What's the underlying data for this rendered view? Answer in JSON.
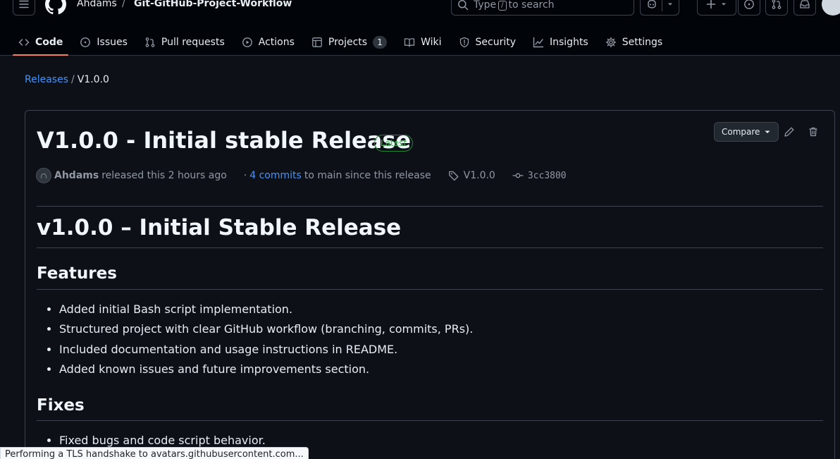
{
  "header": {
    "owner": "Ahdams",
    "separator": "/",
    "repo": "Git-GitHub-Project-Workflow",
    "search": {
      "prefix": "Type",
      "key": "/",
      "suffix": "to search"
    }
  },
  "tabs": [
    {
      "label": "Code",
      "icon": "code-icon"
    },
    {
      "label": "Issues",
      "icon": "issue-opened-icon"
    },
    {
      "label": "Pull requests",
      "icon": "git-pull-request-icon"
    },
    {
      "label": "Actions",
      "icon": "play-icon"
    },
    {
      "label": "Projects",
      "icon": "table-icon",
      "count": "1"
    },
    {
      "label": "Wiki",
      "icon": "book-icon"
    },
    {
      "label": "Security",
      "icon": "shield-icon"
    },
    {
      "label": "Insights",
      "icon": "graph-icon"
    },
    {
      "label": "Settings",
      "icon": "gear-icon"
    }
  ],
  "breadcrumb": {
    "parent": "Releases",
    "separator": "/",
    "current": "V1.0.0"
  },
  "release": {
    "title": "V1.0.0 - Initial stable Release",
    "badge": "Latest",
    "compare_label": "Compare",
    "author": "Ahdams",
    "released_text": "released this 2 hours ago",
    "commits_prefix": "·",
    "commits_link": "4 commits",
    "commits_suffix": "to main since this release",
    "tag": "V1.0.0",
    "sha": "3cc3800"
  },
  "notes": {
    "heading": "v1.0.0 – Initial Stable Release",
    "features_heading": "Features",
    "features": [
      "Added initial Bash script implementation.",
      "Structured project with clear GitHub workflow (branching, commits, PRs).",
      "Included documentation and usage instructions in README.",
      "Added known issues and future improvements section."
    ],
    "fixes_heading": "Fixes",
    "fixes": [
      "Fixed bugs and code script behavior."
    ]
  },
  "status_bar": "Performing a TLS handshake to avatars.githubusercontent.com..."
}
